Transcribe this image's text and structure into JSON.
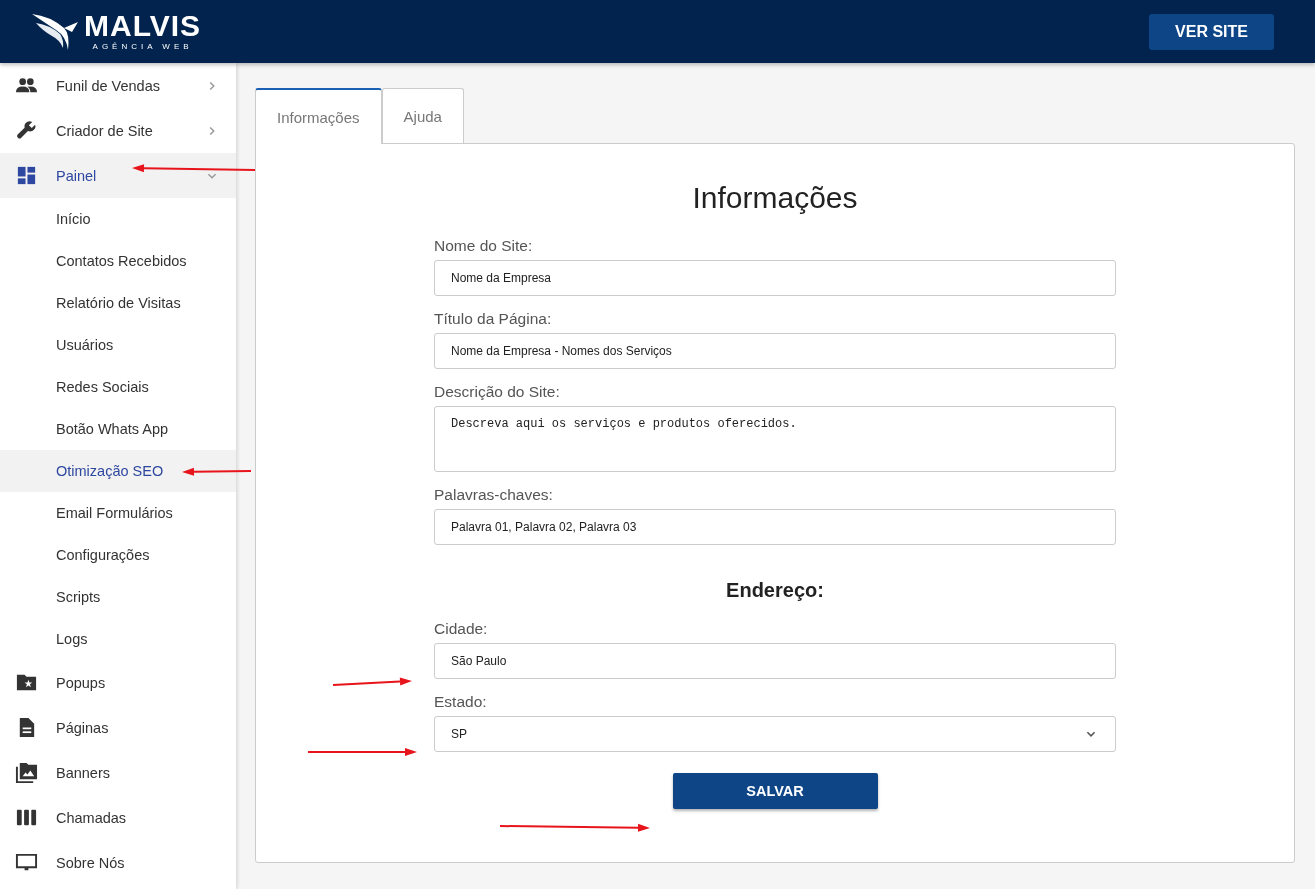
{
  "header": {
    "logo_name": "MALVIS",
    "logo_tagline": "AGÊNCIA WEB",
    "button": "VER SITE"
  },
  "sidebar": {
    "items": [
      {
        "label": "Funil de Vendas",
        "selected": false,
        "expanded": false
      },
      {
        "label": "Criador de Site",
        "selected": false,
        "expanded": false
      },
      {
        "label": "Painel",
        "selected": true,
        "expanded": true,
        "children": [
          {
            "label": "Início",
            "selected": false
          },
          {
            "label": "Contatos Recebidos",
            "selected": false
          },
          {
            "label": "Relatório de Visitas",
            "selected": false
          },
          {
            "label": "Usuários",
            "selected": false
          },
          {
            "label": "Redes Sociais",
            "selected": false
          },
          {
            "label": "Botão Whats App",
            "selected": false
          },
          {
            "label": "Otimização SEO",
            "selected": true
          },
          {
            "label": "Email Formulários",
            "selected": false
          },
          {
            "label": "Configurações",
            "selected": false
          },
          {
            "label": "Scripts",
            "selected": false
          },
          {
            "label": "Logs",
            "selected": false
          }
        ]
      },
      {
        "label": "Popups",
        "selected": false
      },
      {
        "label": "Páginas",
        "selected": false
      },
      {
        "label": "Banners",
        "selected": false
      },
      {
        "label": "Chamadas",
        "selected": false
      },
      {
        "label": "Sobre Nós",
        "selected": false
      }
    ]
  },
  "tabs": [
    {
      "label": "Informações",
      "selected": true
    },
    {
      "label": "Ajuda",
      "selected": false
    }
  ],
  "form": {
    "title": "Informações",
    "fields": [
      {
        "kind": "text",
        "label": "Nome do Site:",
        "value": "Nome da Empresa"
      },
      {
        "kind": "text",
        "label": "Título da Página:",
        "value": "Nome da Empresa - Nomes dos Serviços"
      },
      {
        "kind": "textarea",
        "label": "Descrição do Site:",
        "value": "Descreva aqui os serviços e produtos oferecidos."
      },
      {
        "kind": "text",
        "label": "Palavras-chaves:",
        "value": "Palavra 01, Palavra 02, Palavra 03"
      }
    ],
    "address_title": "Endereço:",
    "address_fields": [
      {
        "kind": "text",
        "label": "Cidade:",
        "value": "São Paulo"
      },
      {
        "kind": "select",
        "label": "Estado:",
        "value": "SP"
      }
    ],
    "submit": "SALVAR"
  }
}
